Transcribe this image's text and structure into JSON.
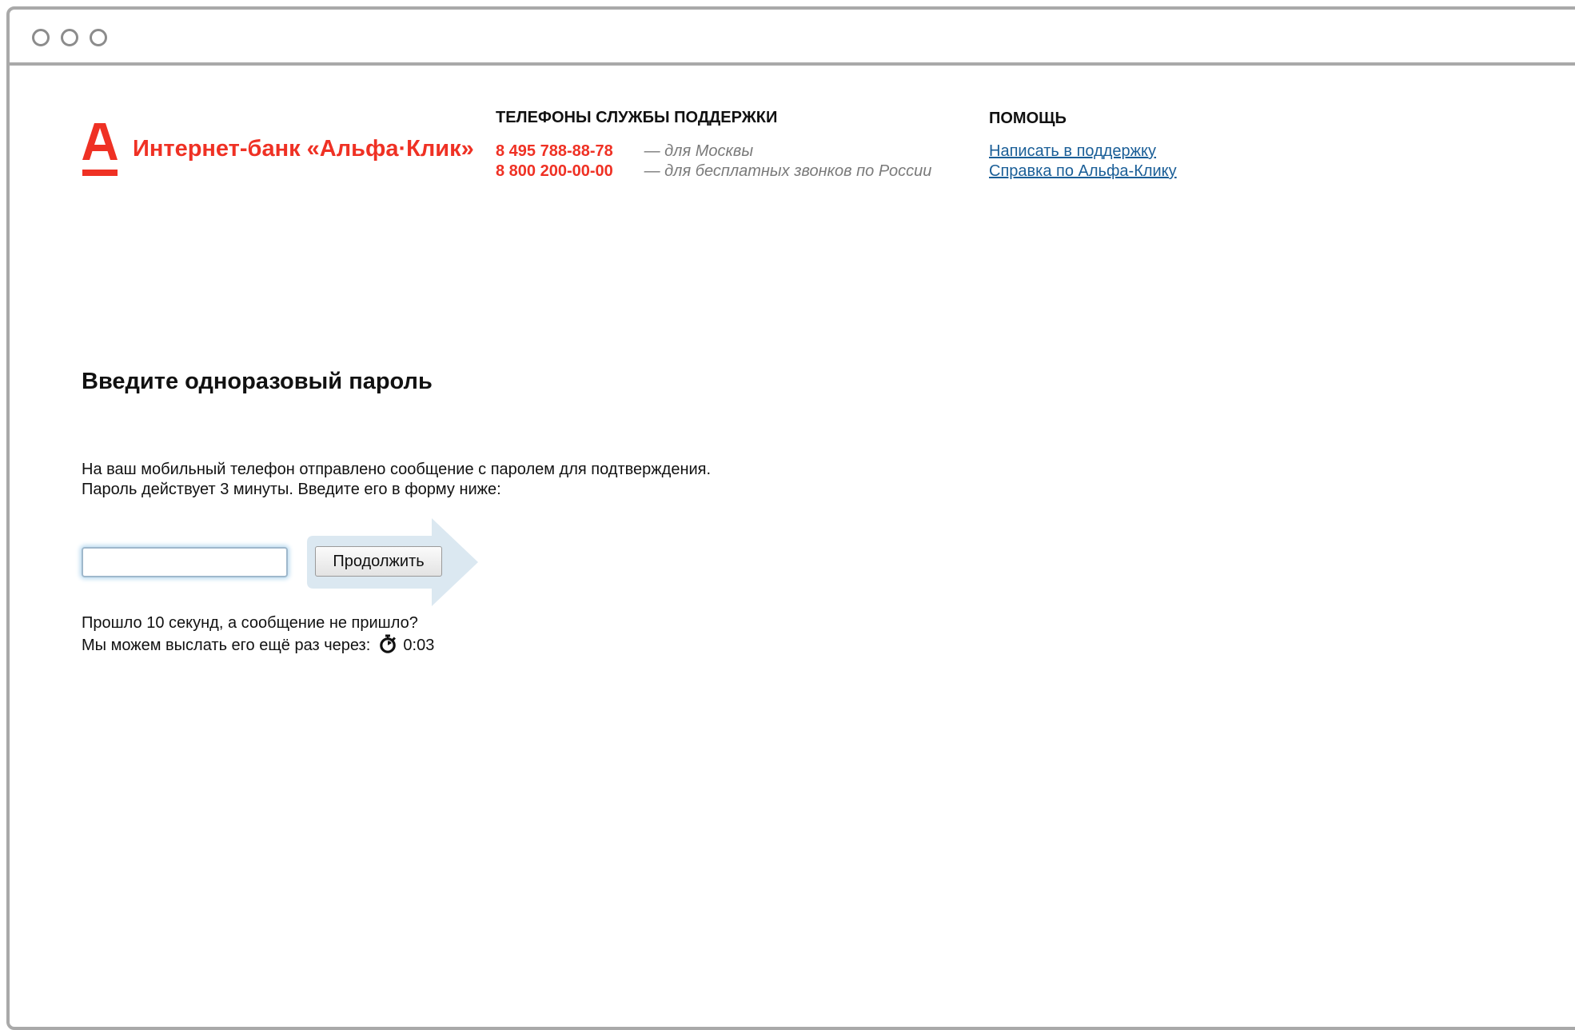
{
  "header": {
    "brand_name": "Интернет-банк «Альфа·Клик»",
    "logo_icon": "alfa-letter-a-icon",
    "support": {
      "title": "ТЕЛЕФОНЫ СЛУЖБЫ ПОДДЕРЖКИ",
      "phones": [
        {
          "number": "8 495 788-88-78",
          "note": "— для Москвы"
        },
        {
          "number": "8 800 200-00-00",
          "note": "— для бесплатных звонков по России"
        }
      ]
    },
    "help": {
      "title": "ПОМОЩЬ",
      "links": [
        "Написать в поддержку",
        "Справка по Альфа-Клику"
      ]
    }
  },
  "main": {
    "heading": "Введите одноразовый пароль",
    "info_lines": [
      "На ваш мобильный телефон отправлено сообщение с паролем для подтверждения.",
      "Пароль действует 3 минуты. Введите его в форму ниже:"
    ],
    "password_input": {
      "value": "",
      "placeholder": ""
    },
    "continue_label": "Продолжить",
    "resend_line_1": "Прошло 10 секунд, а сообщение не пришло?",
    "resend_line_2": "Мы можем выслать его ещё раз через:",
    "timer_icon": "stopwatch-icon",
    "timer_value": "0:03"
  },
  "colors": {
    "brand_red": "#ef3124",
    "link_blue": "#1a5e97",
    "note_gray": "#7a7a7a",
    "arrow_hint": "#dbe8f1"
  }
}
